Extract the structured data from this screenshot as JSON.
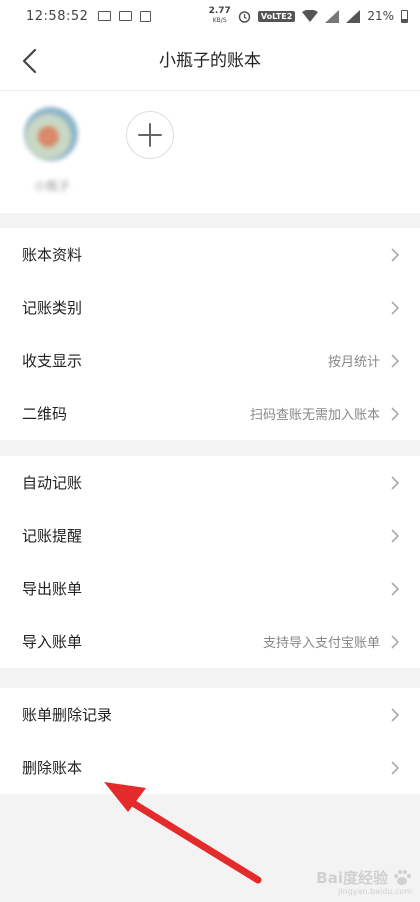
{
  "status_bar": {
    "time": "12:58:52",
    "net_speed": "2.77",
    "net_unit": "KB/S",
    "volte": "VoLTE2",
    "battery": "21%"
  },
  "nav": {
    "title": "小瓶子的账本"
  },
  "members": {
    "name": "小瓶子"
  },
  "group1": [
    {
      "label": "账本资料",
      "value": ""
    },
    {
      "label": "记账类别",
      "value": ""
    },
    {
      "label": "收支显示",
      "value": "按月统计"
    },
    {
      "label": "二维码",
      "value": "扫码查账无需加入账本"
    }
  ],
  "group2": [
    {
      "label": "自动记账",
      "value": ""
    },
    {
      "label": "记账提醒",
      "value": ""
    },
    {
      "label": "导出账单",
      "value": ""
    },
    {
      "label": "导入账单",
      "value": "支持导入支付宝账单"
    }
  ],
  "group3": [
    {
      "label": "账单删除记录",
      "value": ""
    },
    {
      "label": "删除账本",
      "value": ""
    }
  ],
  "annotation": {
    "arrow_color": "#e32b2b"
  },
  "watermark": {
    "brand": "Bai度经验",
    "site": "jingyan.baidu.com"
  }
}
